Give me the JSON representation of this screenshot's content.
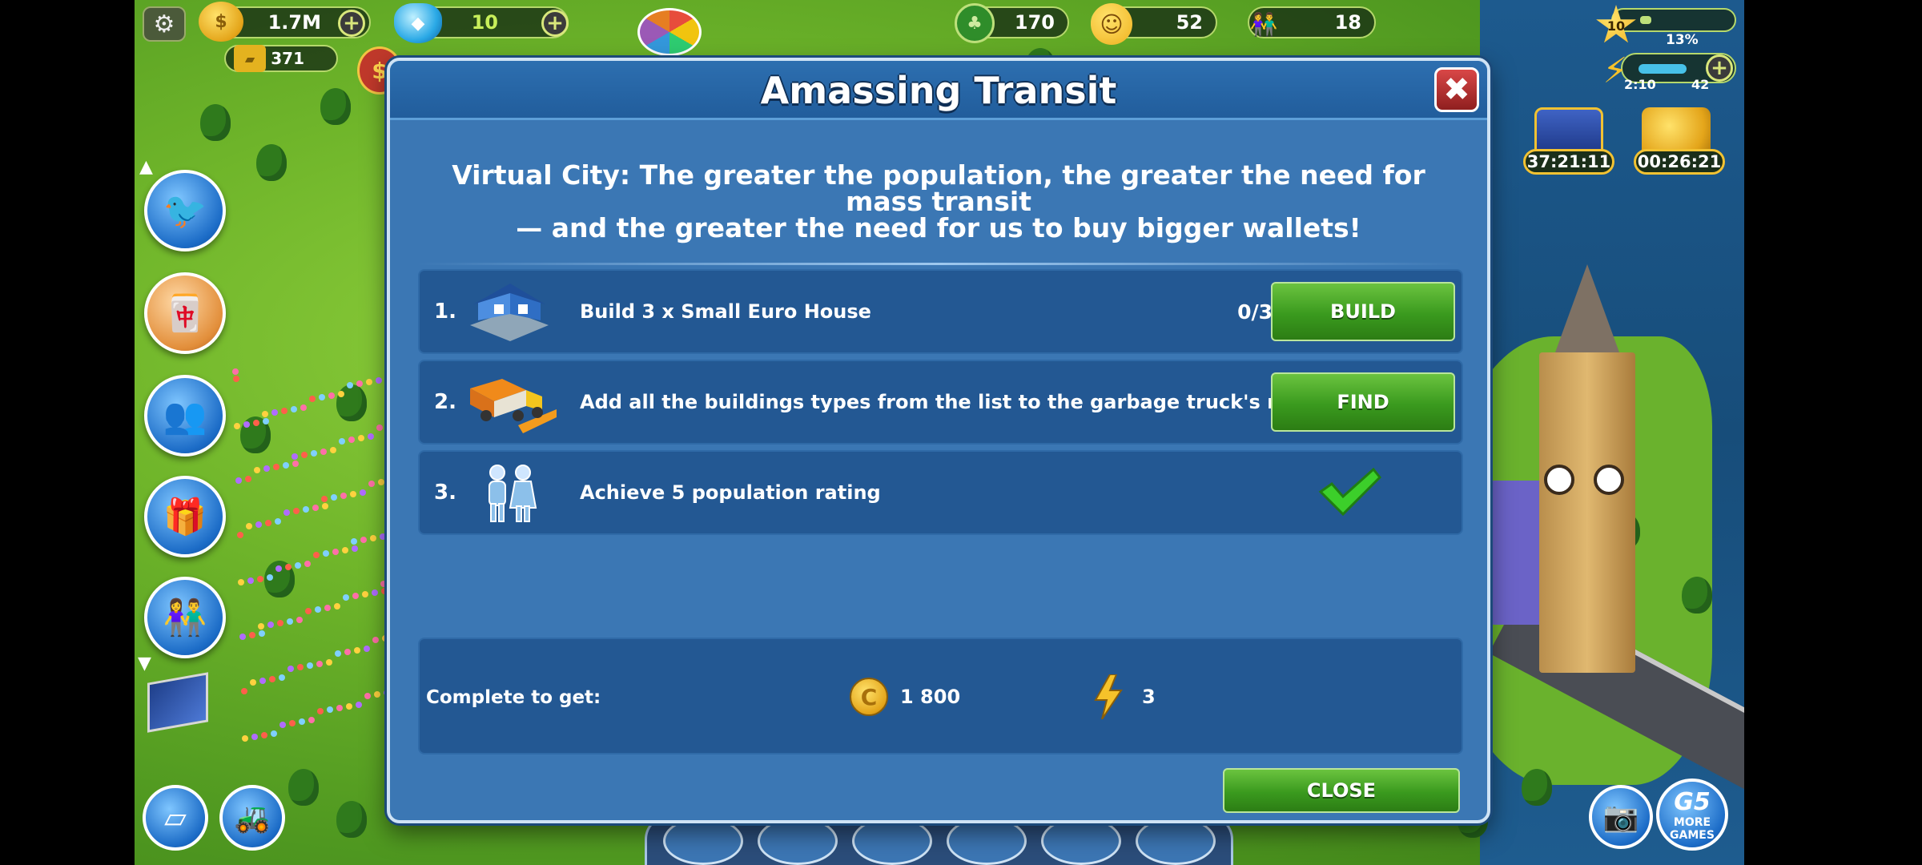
{
  "hud": {
    "coins": "1.7M",
    "gems": "10",
    "gold_bars": "371",
    "trees": "170",
    "happiness": "52",
    "population": "18",
    "level": "10",
    "xp_percent": "13%",
    "energy_timer": "2:10",
    "energy": "42",
    "chest_timer": "37:21:11",
    "gold_timer": "00:26:21"
  },
  "side_buttons": [
    {
      "name": "twitter-g5-button",
      "icon": "twitter-icon"
    },
    {
      "name": "mahjong-game-button",
      "icon": "mahjong-icon"
    },
    {
      "name": "add-friends-button",
      "icon": "friends-icon"
    },
    {
      "name": "gift-button",
      "icon": "gift-icon"
    },
    {
      "name": "population-button",
      "icon": "people-icon"
    }
  ],
  "dialog": {
    "title": "Amassing Transit",
    "description_line1": "Virtual City: The greater the population, the greater the need for mass transit",
    "description_line2": "— and the greater the need for us to buy bigger wallets!",
    "tasks": [
      {
        "num": "1.",
        "text": "Build 3 x Small Euro House",
        "progress": "0/3",
        "button": "BUILD"
      },
      {
        "num": "2.",
        "text": "Add all the buildings types from the list to the garbage truck's route",
        "progress": "",
        "button": "FIND"
      },
      {
        "num": "3.",
        "text": "Achieve 5 population rating",
        "progress": "",
        "button": ""
      }
    ],
    "reward_label": "Complete to get:",
    "reward_coins": "1 800",
    "reward_energy": "3",
    "close_label": "CLOSE"
  },
  "bottom_right": {
    "more_games_line1": "MORE",
    "more_games_line2": "GAMES",
    "logo": "G5"
  },
  "colors": {
    "dialog_bg": "#3b77b4",
    "row_bg": "#235893",
    "green_button": "#3a9a1e",
    "close_red": "#c23a3a"
  }
}
